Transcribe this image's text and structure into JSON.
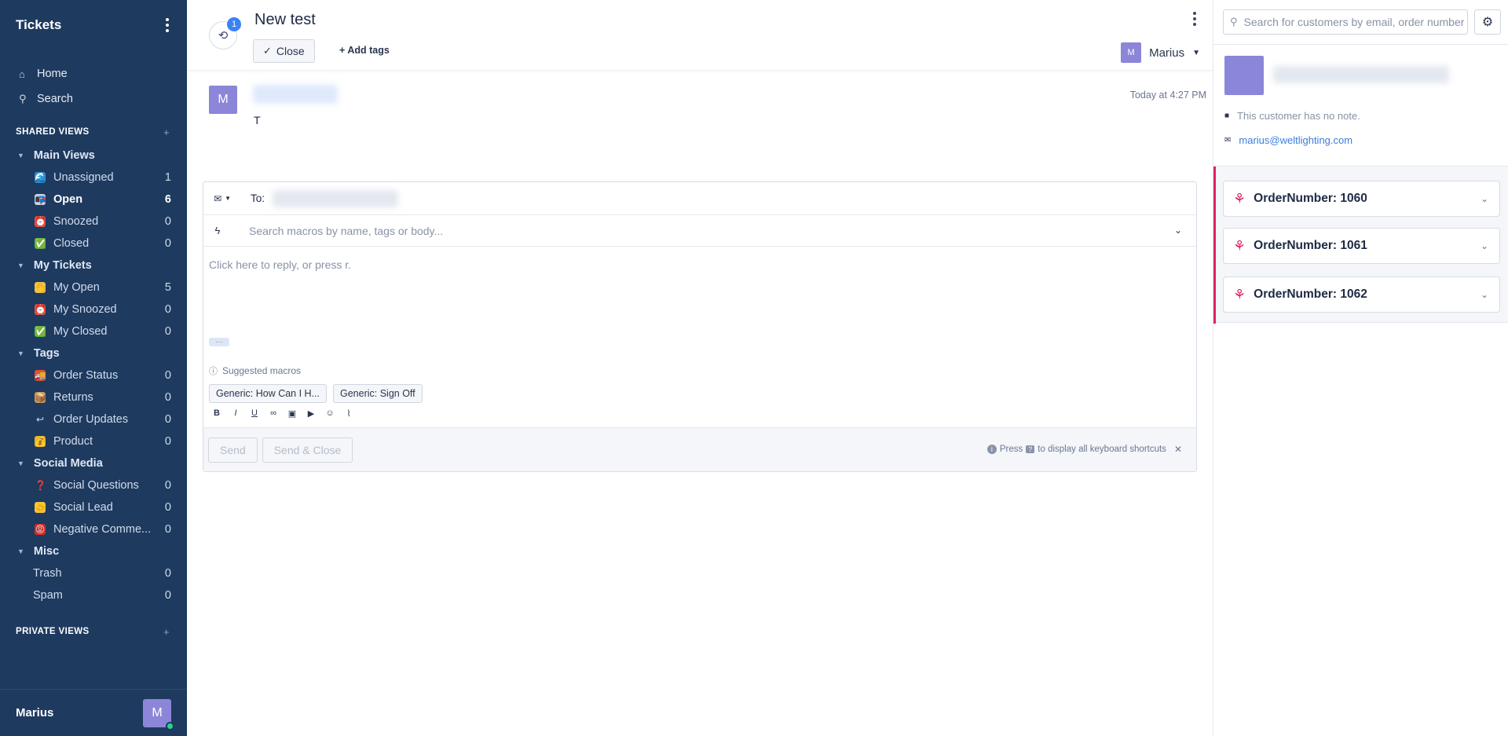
{
  "sidebar": {
    "title": "Tickets",
    "nav": [
      {
        "label": "Home"
      },
      {
        "label": "Search"
      }
    ],
    "shared_views_label": "SHARED VIEWS",
    "groups": [
      {
        "label": "Main Views",
        "items": [
          {
            "label": "Unassigned",
            "count": "1",
            "emoji": "🌊",
            "color": "#2f8fd8"
          },
          {
            "label": "Open",
            "count": "6",
            "emoji": "📭",
            "color": "#c9d4e5"
          },
          {
            "label": "Snoozed",
            "count": "0",
            "emoji": "⏰",
            "color": "#e74c3c"
          },
          {
            "label": "Closed",
            "count": "0",
            "emoji": "✅",
            "color": "#2ecc40"
          }
        ]
      },
      {
        "label": "My Tickets",
        "items": [
          {
            "label": "My Open",
            "count": "5",
            "emoji": "👋",
            "color": "#f5c242"
          },
          {
            "label": "My Snoozed",
            "count": "0",
            "emoji": "⏰",
            "color": "#e74c3c"
          },
          {
            "label": "My Closed",
            "count": "0",
            "emoji": "✅",
            "color": "#2ecc40"
          }
        ]
      },
      {
        "label": "Tags",
        "items": [
          {
            "label": "Order Status",
            "count": "0",
            "emoji": "🚚",
            "color": "#e0532e"
          },
          {
            "label": "Returns",
            "count": "0",
            "emoji": "📦",
            "color": "#c99a5b"
          },
          {
            "label": "Order Updates",
            "count": "0",
            "emoji": "↩",
            "color": "transparent"
          },
          {
            "label": "Product",
            "count": "0",
            "emoji": "💰",
            "color": "#e7b72b"
          }
        ]
      },
      {
        "label": "Social Media",
        "items": [
          {
            "label": "Social Questions",
            "count": "0",
            "emoji": "❓",
            "color": "transparent"
          },
          {
            "label": "Social Lead",
            "count": "0",
            "emoji": "🤝",
            "color": "#f5c242"
          },
          {
            "label": "Negative Comme...",
            "count": "0",
            "emoji": "😡",
            "color": "#d62d20"
          }
        ]
      },
      {
        "label": "Misc",
        "items": [
          {
            "label": "Trash",
            "count": "0"
          },
          {
            "label": "Spam",
            "count": "0"
          }
        ]
      }
    ],
    "private_views_label": "PRIVATE VIEWS",
    "user_name": "Marius",
    "user_initial": "M"
  },
  "ticket": {
    "history_count": "1",
    "title": "New test",
    "close_label": "Close",
    "add_tags_label": "Add tags",
    "assignee_name": "Marius",
    "assignee_initial": "M",
    "message": {
      "author_initial": "M",
      "time": "Today at 4:27 PM",
      "body": "T"
    }
  },
  "composer": {
    "to_label": "To:",
    "macro_placeholder": "Search macros by name, tags or body...",
    "reply_placeholder": "Click here to reply, or press r.",
    "suggested_label": "Suggested macros",
    "macros": [
      "Generic: How Can I H...",
      "Generic: Sign Off"
    ],
    "send_label": "Send",
    "send_close_label": "Send & Close",
    "shortcuts_pre": "Press",
    "shortcuts_key": "?",
    "shortcuts_post": "to display all keyboard shortcuts"
  },
  "customer": {
    "search_placeholder": "Search for customers by email, order number",
    "note": "This customer has no note.",
    "email": "marius@weltlighting.com",
    "orders": [
      "OrderNumber: 1060",
      "OrderNumber: 1061",
      "OrderNumber: 1062"
    ]
  },
  "colors": {
    "sidebar_bg": "#1e3a5f",
    "accent": "#3b82f6",
    "avatar": "#8b86d8",
    "integration": "#e0245e"
  }
}
